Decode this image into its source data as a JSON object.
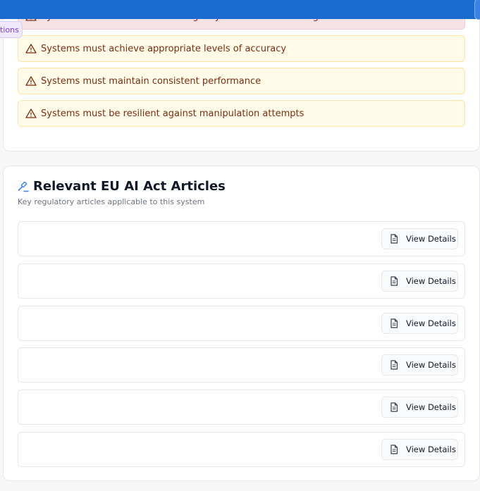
{
  "tab_fragment": "tions",
  "requirements": [
    {
      "text": "Systems must maintain human agency and decision-making",
      "level": "danger"
    },
    {
      "text": "Systems must achieve appropriate levels of accuracy",
      "level": "warning"
    },
    {
      "text": "Systems must maintain consistent performance",
      "level": "warning"
    },
    {
      "text": "Systems must be resilient against manipulation attempts",
      "level": "warning"
    }
  ],
  "articles_section": {
    "title": "Relevant EU AI Act Articles",
    "subtitle": "Key regulatory articles applicable to this system",
    "rows": [
      {
        "button_label": "View Details"
      },
      {
        "button_label": "View Details"
      },
      {
        "button_label": "View Details"
      },
      {
        "button_label": "View Details"
      },
      {
        "button_label": "View Details"
      },
      {
        "button_label": "View Details"
      }
    ]
  },
  "icons": {
    "requirement": "warning-triangle-icon",
    "section": "gavel-icon",
    "button": "document-icon"
  },
  "colors": {
    "header": "#1b6bcf",
    "warning_bg": "#fffbe8",
    "danger_bg": "#f6e1e5",
    "warning_text": "#7c2d12"
  }
}
